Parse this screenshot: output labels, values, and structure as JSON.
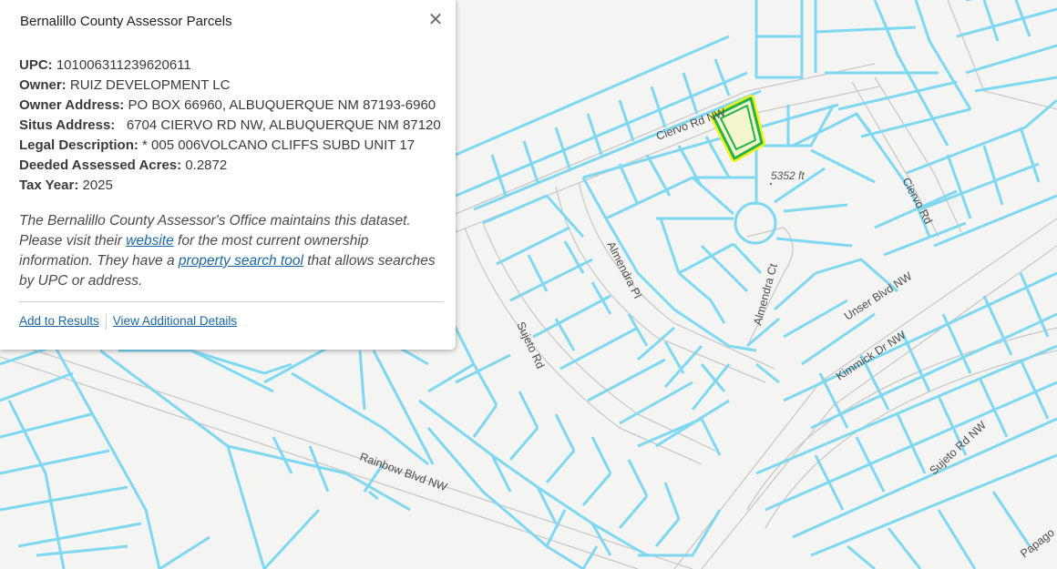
{
  "popup": {
    "title": "Bernalillo County Assessor Parcels",
    "close_symbol": "✕",
    "fields": [
      {
        "label": "UPC:",
        "value": " 101006311239620611"
      },
      {
        "label": "Owner:",
        "value": " RUIZ DEVELOPMENT LC"
      },
      {
        "label": "Owner Address:",
        "value": " PO BOX 66960, ALBUQUERQUE NM 87193-6960"
      },
      {
        "label": "Situs Address:",
        "value": "   6704 CIERVO RD NW, ALBUQUERQUE NM 87120"
      },
      {
        "label": "Legal Description:",
        "value": " * 005 006VOLCANO CLIFFS SUBD UNIT 17"
      },
      {
        "label": "Deeded Assessed Acres:",
        "value": " 0.2872"
      },
      {
        "label": "Tax Year:",
        "value": " 2025"
      }
    ],
    "note": {
      "part1": "The Bernalillo County Assessor's Office maintains this dataset. Please visit their ",
      "link1": "website",
      "part2": " for the most current ownership information. They have a ",
      "link2": "property search tool",
      "part3": " that allows searches by UPC or address."
    },
    "actions": {
      "add_to_results": "Add to Results",
      "view_details": "View Additional Details"
    }
  },
  "map": {
    "colors": {
      "parcel_line": "#7fd8f2",
      "road_edge": "#c4c4c4",
      "background": "#f4f4f2",
      "selected_outline": "#25b24a",
      "selected_glow": "#f2f21a",
      "selected_fill": "#f3f6cc"
    },
    "road_labels": {
      "ciervo_rd_nw": "Ciervo Rd NW",
      "ciervo_rd": "Ciervo Rd",
      "almendra_pl": "Almendra Pl",
      "almendra_ct": "Almendra Ct",
      "sujeto_rd": "Sujeto Rd",
      "unser_blvd": "Unser Blvd NW",
      "kimmick_dr": "Kimmick Dr NW",
      "rainbow_blvd": "Rainbow Blvd NW",
      "sujeto_rd_nw": "Sujeto Rd NW",
      "papago": "Papago"
    },
    "elevation_label": "5352 ft"
  }
}
